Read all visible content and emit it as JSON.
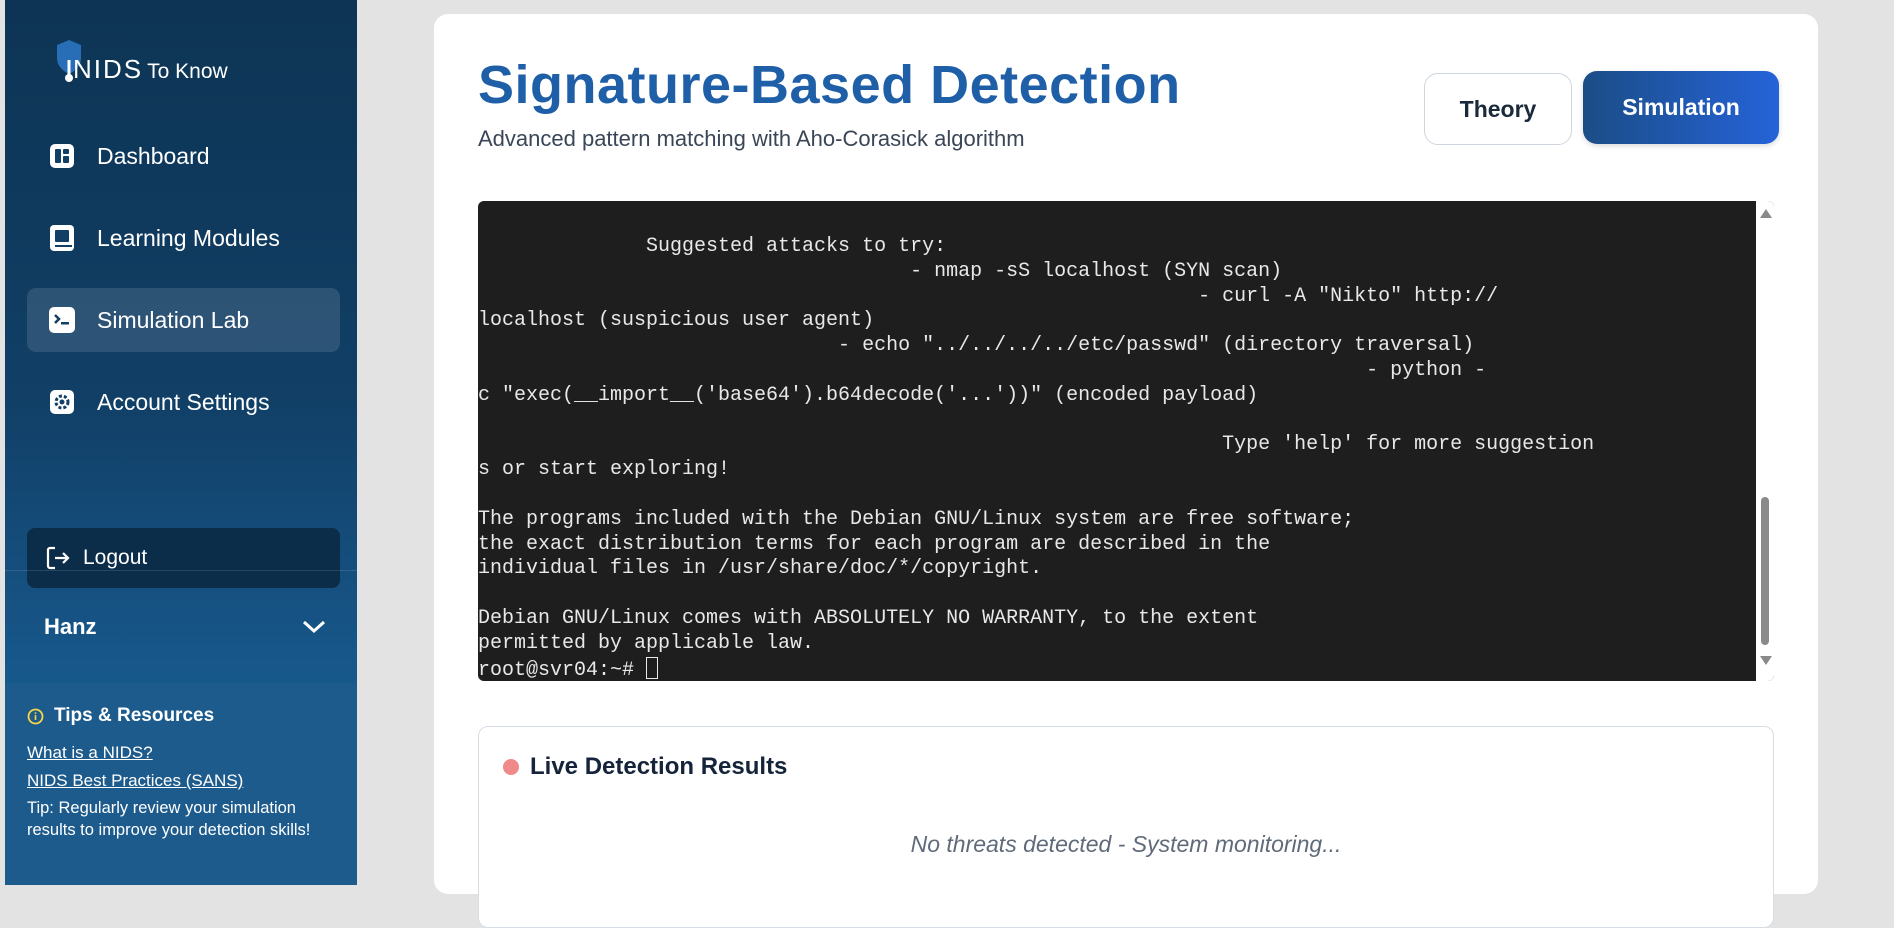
{
  "app": {
    "logo_main": "NIDS",
    "logo_sub": "To Know"
  },
  "sidebar": {
    "items": [
      {
        "label": "Dashboard",
        "icon": "dashboard-icon"
      },
      {
        "label": "Learning Modules",
        "icon": "book-icon"
      },
      {
        "label": "Simulation Lab",
        "icon": "terminal-icon",
        "active": true
      },
      {
        "label": "Account Settings",
        "icon": "gear-icon"
      }
    ],
    "logout_label": "Logout",
    "user_name": "Hanz",
    "tips": {
      "title": "Tips & Resources",
      "links": [
        "What is a NIDS?",
        "NIDS Best Practices (SANS)"
      ],
      "tip": "Tip: Regularly review your simulation results to improve your detection skills!"
    }
  },
  "main": {
    "title": "Signature-Based Detection",
    "subtitle": "Advanced pattern matching with Aho-Corasick algorithm",
    "tabs": [
      {
        "label": "Theory",
        "active": false
      },
      {
        "label": "Simulation",
        "active": true
      }
    ],
    "terminal": {
      "lines": [
        "              Suggested attacks to try:",
        "                                    - nmap -sS localhost (SYN scan)",
        "                                                            - curl -A \"Nikto\" http://",
        "localhost (suspicious user agent)",
        "                              - echo \"../../../../etc/passwd\" (directory traversal)",
        "                                                                          - python -",
        "c \"exec(__import__('base64').b64decode('...'))\" (encoded payload)",
        "",
        "                                                              Type 'help' for more suggestion",
        "s or start exploring!",
        "",
        "The programs included with the Debian GNU/Linux system are free software;",
        "the exact distribution terms for each program are described in the",
        "individual files in /usr/share/doc/*/copyright.",
        "",
        "Debian GNU/Linux comes with ABSOLUTELY NO WARRANTY, to the extent",
        "permitted by applicable law."
      ],
      "prompt": "root@svr04:~# "
    },
    "results": {
      "title": "Live Detection Results",
      "status_color": "#f08a8a",
      "message": "No threats detected - System monitoring..."
    }
  },
  "colors": {
    "accent": "#1f5fa8",
    "sidebar_dark": "#0d3454",
    "terminal_bg": "#1e1e1e"
  }
}
